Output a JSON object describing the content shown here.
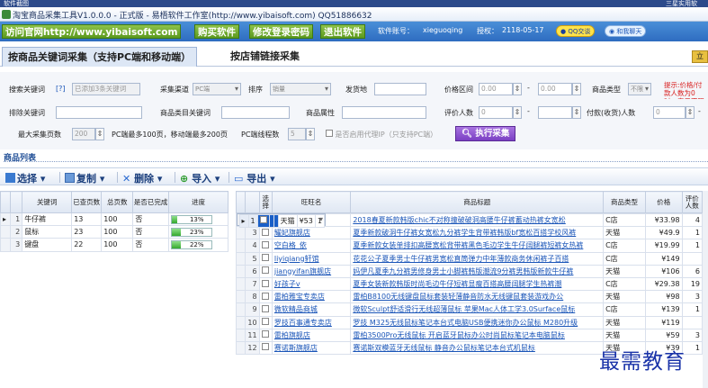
{
  "window": {
    "corner_left": "软件截图",
    "corner_right": "三星实用软",
    "title": "淘宝商品采集工具V1.0.0.0 - 正式版 - 易梧软件工作室(http://www.yibaisoft.com) QQ51886632"
  },
  "topbar": {
    "visit_btn": "访问官网http://www.yibaisoft.com",
    "buy_btn": "购买软件",
    "pwd_btn": "修改登录密码",
    "exit_btn": "退出软件",
    "account_label": "软件账号：",
    "account_value": "xieguoqing",
    "auth_label": "授权：",
    "auth_value": "2118-05-17",
    "qq_btn": "QQ交谈",
    "share_btn": "和我聊天"
  },
  "tabs": [
    {
      "label": "按商品关键词采集（支持PC端和移动端）"
    },
    {
      "label": "按店铺链接采集"
    }
  ],
  "tab_badge": "立",
  "form": {
    "search_kw_label": "搜索关键词",
    "search_kw_help": "[?]",
    "search_kw_placeholder": "已添加3条关键词",
    "channel_label": "采集渠道",
    "channel_value": "PC端",
    "sort_label": "排序",
    "sort_value": "销量",
    "ship_label": "发货地",
    "price_label": "价格区间",
    "price_min": "0.00",
    "price_max": "0.00",
    "dash": "-",
    "type_label": "商品类型",
    "type_value": "不限",
    "tip": "提示:价格/付款人数为0时，表示不限",
    "exclude_kw_label": "排除关键词",
    "title_kw_label": "商品类目关键词",
    "attr_label": "商品属性",
    "review_label": "评价人数",
    "review_min": "0",
    "pay_label": "付款(收货)人数",
    "pay_min": "0",
    "max_pages_label": "最大采集页数",
    "max_pages_value": "200",
    "max_pages_note": "PC端最多100页，移动端最多200页",
    "threads_label": "PC端线程数",
    "threads_value": "5",
    "proxy_label": "是否启用代理IP（只支持PC端）",
    "exec_btn": "执行采集"
  },
  "list_header": "商品列表",
  "toolbar": {
    "select": "选择",
    "copy": "复制",
    "delete": "删除",
    "import": "导入",
    "export": "导出"
  },
  "left_table": {
    "headers": [
      "关键词",
      "已查页数",
      "总页数",
      "是否已完成",
      "进度"
    ],
    "rows": [
      {
        "n": "1",
        "kw": "牛仔裤",
        "done": "13",
        "total": "100",
        "fin": "否",
        "pct": 13,
        "pct_text": "13%"
      },
      {
        "n": "2",
        "kw": "鼠标",
        "done": "23",
        "total": "100",
        "fin": "否",
        "pct": 23,
        "pct_text": "23%"
      },
      {
        "n": "3",
        "kw": "键盘",
        "done": "22",
        "total": "100",
        "fin": "否",
        "pct": 22,
        "pct_text": "22%"
      }
    ]
  },
  "right_table": {
    "headers": [
      "选择",
      "旺旺名",
      "商品标题",
      "商品类型",
      "价格",
      "评价人数"
    ],
    "rows": [
      {
        "n": "1",
        "shop": "",
        "title": "",
        "type": "天猫",
        "price": "¥53",
        "rev": "1"
      },
      {
        "n": "2",
        "shop": "俪影旗舰店",
        "title": "2018春夏新款韩版chic不对称撞破破洞高腰牛仔裤蓄动热裤女宽松",
        "type": "C店",
        "price": "¥33.98",
        "rev": "4"
      },
      {
        "n": "3",
        "shop": "耀妃旗舰店",
        "title": "夏季新款破洞牛仔裤女宽松九分裤学生背带裤韩版bf宽松百搭学校风裤",
        "type": "天猫",
        "price": "¥49.9",
        "rev": "1"
      },
      {
        "n": "4",
        "shop": "空白格_依",
        "title": "夏季新款女装单排扣高腰宽松背带裤黑色毛边学生牛仔阔腿裤短裤女热裤",
        "type": "C店",
        "price": "¥19.99",
        "rev": "1"
      },
      {
        "n": "5",
        "shop": "liyiqiang轩馆",
        "title": "花花公子夏季男士牛仔裤男宽松直筒弹力中年薄款商务休闲裤子百搭",
        "type": "C店",
        "price": "¥149",
        "rev": ""
      },
      {
        "n": "6",
        "shop": "jiangyifan旗舰店",
        "title": "妈伊凡夏季九分裤男修身男士小脚裤韩版潮流9分裤男韩版新款牛仔裤",
        "type": "天猫",
        "price": "¥106",
        "rev": "6"
      },
      {
        "n": "7",
        "shop": "好孩子v",
        "title": "夏季女装新款韩版时尚毛边牛仔短裤显瘦百搭高腰阔腿学生热裤潮",
        "type": "C店",
        "price": "¥29.38",
        "rev": "19"
      },
      {
        "n": "8",
        "shop": "雷柏雅宝专卖店",
        "title": "雷柏B8100无线键盘鼠标套装轻薄静音防水无线键鼠套装游戏办公",
        "type": "天猫",
        "price": "¥98",
        "rev": "3"
      },
      {
        "n": "9",
        "shop": "微软精品商城",
        "title": "微软Sculpt舒适滑行无线超薄鼠标 苹果Mac人体工学3.0Surface鼠标",
        "type": "C店",
        "price": "¥139",
        "rev": "1"
      },
      {
        "n": "10",
        "shop": "罗技百事通专卖店",
        "title": "罗技 M325无线鼠标笔记本台式电脑USB便携迷你办公鼠标 M280升级",
        "type": "天猫",
        "price": "¥119",
        "rev": ""
      },
      {
        "n": "11",
        "shop": "雷柏旗舰店",
        "title": "雷柏3500Pro无线鼠标 开启蓝牙鼠标办公时尚鼠标笔记本电脑鼠标",
        "type": "天猫",
        "price": "¥59",
        "rev": "3"
      },
      {
        "n": "12",
        "shop": "赛诺斯旗舰店",
        "title": "赛诺斯双模蓝牙无线鼠标 静音办公鼠标笔记本台式机鼠标",
        "type": "天猫",
        "price": "¥39",
        "rev": "1"
      }
    ]
  },
  "watermark": "最需教育",
  "colors": {
    "topbar": "#2e6cc0",
    "green_btn": "#5c9a1e",
    "exec_btn": "#7a3fc3",
    "selection": "#1a5fc7",
    "link": "#1a55b8",
    "watermark": "#1a33a8"
  }
}
